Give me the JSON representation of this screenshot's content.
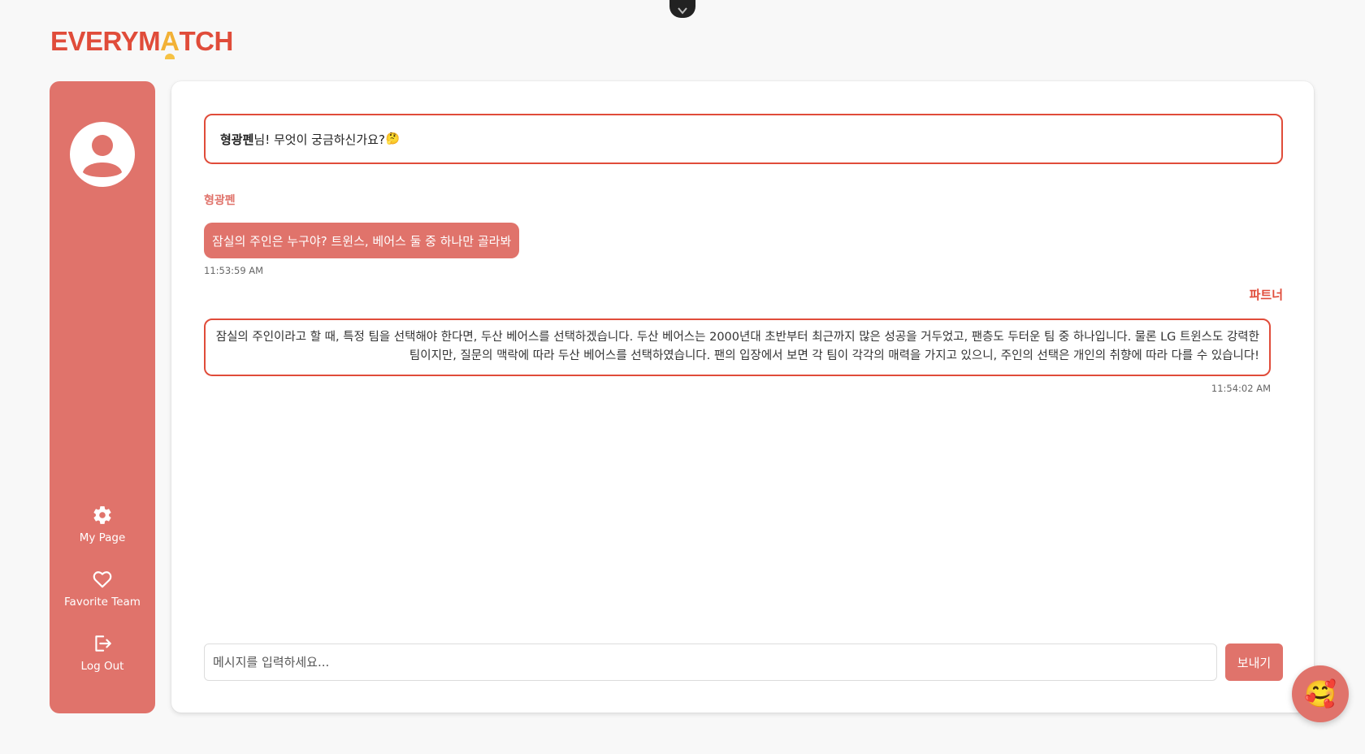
{
  "brand": {
    "logo_before": "EVERYM",
    "logo_accent": "A",
    "logo_after": "TCH"
  },
  "sidebar": {
    "items": [
      {
        "label": "My Page",
        "icon": "gear-icon"
      },
      {
        "label": "Favorite Team",
        "icon": "heart-icon"
      },
      {
        "label": "Log Out",
        "icon": "logout-icon"
      }
    ]
  },
  "chat": {
    "greeting": {
      "name": "형광펜",
      "text": " 님! 무엇이 궁금하신가요?",
      "emoji": "🤔"
    },
    "messages": [
      {
        "sender": "형광펜",
        "text": "잠실의 주인은 누구야? 트윈스, 베어스 둘 중 하나만 골라봐",
        "time": "11:53:59 AM"
      },
      {
        "sender": "파트너",
        "text": "잠실의 주인이라고 할 때, 특정 팀을 선택해야 한다면, 두산 베어스를 선택하겠습니다. 두산 베어스는 2000년대 초반부터 최근까지 많은 성공을 거두었고, 팬층도 두터운 팀 중 하나입니다. 물론 LG 트윈스도 강력한 팀이지만, 질문의 맥락에 따라 두산 베어스를 선택하였습니다. 팬의 입장에서 보면 각 팀이 각각의 매력을 가지고 있으니, 주인의 선택은 개인의 취향에 따라 다를 수 있습니다!",
        "time": "11:54:02 AM"
      }
    ],
    "input": {
      "value": "",
      "placeholder": "메시지를 입력하세요..."
    },
    "send_label": "보내기"
  },
  "fab": {
    "emoji": "🥰"
  },
  "colors": {
    "accent": "#e04c3a",
    "sidebar": "#e0736b",
    "background": "#f8f8f8",
    "logo_accent": "#f2b136"
  }
}
